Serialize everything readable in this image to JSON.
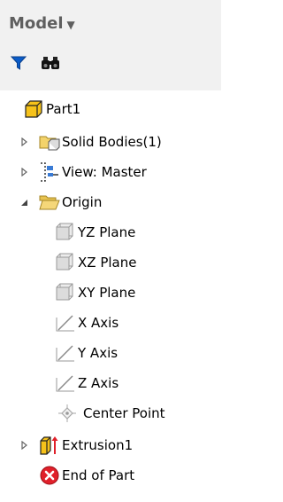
{
  "panel": {
    "title": "Model",
    "dropdown_icon": "caret-down-icon",
    "tools": [
      {
        "name": "filter-icon"
      },
      {
        "name": "binoculars-icon"
      }
    ]
  },
  "tree": [
    {
      "label": "Part1",
      "icon": "part-icon",
      "expander": "none"
    },
    {
      "label": "Solid Bodies(1)",
      "icon": "solid-bodies-folder-icon",
      "expander": "collapsed"
    },
    {
      "label": "View: Master",
      "icon": "view-rep-icon",
      "expander": "collapsed"
    },
    {
      "label": "Origin",
      "icon": "folder-open-icon",
      "expander": "expanded"
    },
    {
      "label": "YZ Plane",
      "icon": "plane-icon",
      "expander": "none"
    },
    {
      "label": "XZ Plane",
      "icon": "plane-icon",
      "expander": "none"
    },
    {
      "label": "XY Plane",
      "icon": "plane-icon",
      "expander": "none"
    },
    {
      "label": "X Axis",
      "icon": "axis-icon",
      "expander": "none"
    },
    {
      "label": "Y Axis",
      "icon": "axis-icon",
      "expander": "none"
    },
    {
      "label": "Z Axis",
      "icon": "axis-icon",
      "expander": "none"
    },
    {
      "label": "Center Point",
      "icon": "center-point-icon",
      "expander": "none"
    },
    {
      "label": "Extrusion1",
      "icon": "extrusion-icon",
      "expander": "collapsed"
    },
    {
      "label": "End of Part",
      "icon": "end-of-part-icon",
      "expander": "none"
    }
  ],
  "colors": {
    "header_bg": "#f1f1f1",
    "title": "#5f5f5f",
    "part_yellow": "#f6c21a",
    "end_red": "#e0202a"
  }
}
